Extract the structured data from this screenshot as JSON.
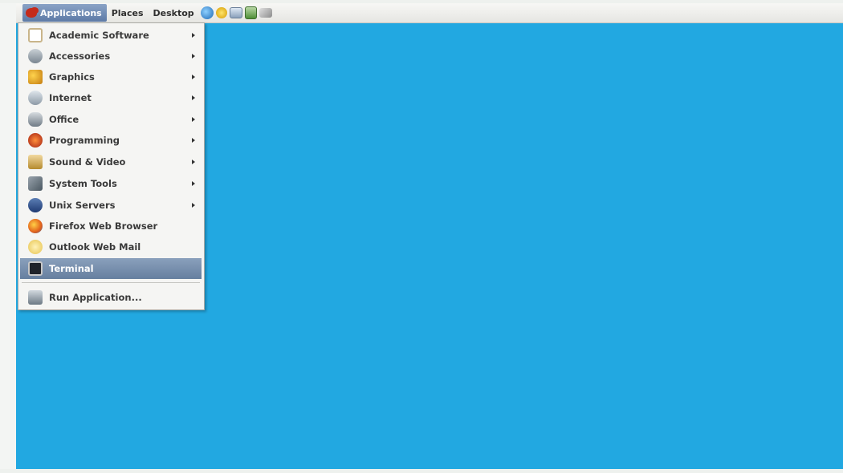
{
  "panel": {
    "applications_label": "Applications",
    "places_label": "Places",
    "desktop_label": "Desktop",
    "launchers": [
      "globe-icon",
      "star-icon",
      "mail-icon",
      "shield-icon",
      "pen-icon"
    ]
  },
  "menu": {
    "items": [
      {
        "label": "Academic Software",
        "icon": "academic-icon",
        "submenu": true
      },
      {
        "label": "Accessories",
        "icon": "accessories-icon",
        "submenu": true
      },
      {
        "label": "Graphics",
        "icon": "graphics-icon",
        "submenu": true
      },
      {
        "label": "Internet",
        "icon": "internet-icon",
        "submenu": true
      },
      {
        "label": "Office",
        "icon": "office-icon",
        "submenu": true
      },
      {
        "label": "Programming",
        "icon": "programming-icon",
        "submenu": true
      },
      {
        "label": "Sound & Video",
        "icon": "sound-video-icon",
        "submenu": true
      },
      {
        "label": "System Tools",
        "icon": "system-tools-icon",
        "submenu": true
      },
      {
        "label": "Unix Servers",
        "icon": "unix-servers-icon",
        "submenu": true
      },
      {
        "label": "Firefox Web Browser",
        "icon": "firefox-icon",
        "submenu": false
      },
      {
        "label": "Outlook Web Mail",
        "icon": "outlook-icon",
        "submenu": false
      },
      {
        "label": "Terminal",
        "icon": "terminal-icon",
        "submenu": false,
        "selected": true
      },
      {
        "label": "Run Application...",
        "icon": "run-icon",
        "submenu": false
      }
    ]
  },
  "colors": {
    "desktop": "#22a8e1",
    "selected_item": "#667f9f"
  }
}
